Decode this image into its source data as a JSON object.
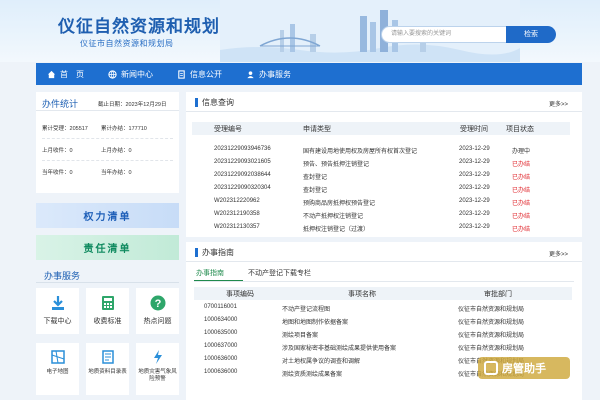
{
  "header": {
    "site_title": "仪征自然资源和规划",
    "site_subtitle": "仪征市自然资源和规划局",
    "search_placeholder": "请输入要搜索的关键词",
    "search_button": "检索"
  },
  "nav": {
    "items": [
      {
        "label": "首　页",
        "icon": "home-icon"
      },
      {
        "label": "新闻中心",
        "icon": "globe-icon"
      },
      {
        "label": "信息公开",
        "icon": "document-icon"
      },
      {
        "label": "办事服务",
        "icon": "user-icon"
      }
    ]
  },
  "stats": {
    "title": "办件统计",
    "date": "截止日期：2023年12月29日",
    "rows": [
      {
        "l1": "累计受理：",
        "v1": "205517",
        "l2": "累计办结：",
        "v2": "177710"
      },
      {
        "l1": "上月收件：",
        "v1": "0",
        "l2": "上月办结：",
        "v2": "0"
      },
      {
        "l1": "当年收件：",
        "v1": "0",
        "l2": "当年办结：",
        "v2": "0"
      }
    ]
  },
  "banners": {
    "power": "权力清单",
    "responsibility": "责任清单"
  },
  "services": {
    "title": "办事服务",
    "cards": [
      {
        "label": "下载中心",
        "icon": "download-icon"
      },
      {
        "label": "收费标准",
        "icon": "calculator-icon"
      },
      {
        "label": "热点问题",
        "icon": "question-icon"
      }
    ],
    "cards2": [
      {
        "label": "电子地图",
        "icon": "map-icon"
      },
      {
        "label": "地质资料目录表",
        "icon": "book-icon"
      },
      {
        "label": "地质灾害气象风险预警",
        "icon": "lightning-icon"
      }
    ]
  },
  "query": {
    "title": "信息查询",
    "more": "更多>>",
    "headers": [
      "受理编号",
      "申请类型",
      "受理时间",
      "项目状态"
    ],
    "rows": [
      {
        "no": "20231229093946736",
        "type": "国有建设用地使用权及房屋所有权首次登记",
        "time": "2023-12-29",
        "state": "办理中"
      },
      {
        "no": "20231229093021605",
        "type": "预告、预告抵押注销登记",
        "time": "2023-12-29",
        "state": "已办结"
      },
      {
        "no": "20231229092038644",
        "type": "查封登记",
        "time": "2023-12-29",
        "state": "已办结"
      },
      {
        "no": "20231229090320304",
        "type": "查封登记",
        "time": "2023-12-29",
        "state": "已办结"
      },
      {
        "no": "W202312220962",
        "type": "预购商品房抵押权预告登记",
        "time": "2023-12-29",
        "state": "已办结"
      },
      {
        "no": "W202312190358",
        "type": "不动产抵押权注销登记",
        "time": "2023-12-29",
        "state": "已办结"
      },
      {
        "no": "W202312130357",
        "type": "抵押权注销登记（过渡）",
        "time": "2023-12-29",
        "state": "已办结"
      }
    ]
  },
  "guide": {
    "title": "办事指南",
    "more": "更多>>",
    "tabs": [
      "办事指南",
      "不动产登记下载专栏"
    ],
    "headers": [
      "事项编码",
      "事项名称",
      "审批部门"
    ],
    "rows": [
      {
        "code": "0700116001",
        "name": "不动产登记流程图",
        "dept": "仪征市自然资源和规划局"
      },
      {
        "code": "1000634000",
        "name": "地图和地图制作依据备案",
        "dept": "仪征市自然资源和规划局"
      },
      {
        "code": "1000635000",
        "name": "测绘项目备案",
        "dept": "仪征市自然资源和规划局"
      },
      {
        "code": "1000637000",
        "name": "涉及国家秘密非基础测绘成果提供使用备案",
        "dept": "仪征市自然资源和规划局"
      },
      {
        "code": "1000636000",
        "name": "对土地权属争议的调查和调解",
        "dept": "仪征市自然资源和规划局"
      },
      {
        "code": "1000636000",
        "name": "测绘资质测绘成果备案",
        "dept": "仪征市自然资源和规划局"
      }
    ]
  },
  "watermark": {
    "text": "房管助手"
  },
  "colors": {
    "primary": "#1e6fd0",
    "done": "#e0282e",
    "green": "#1f8a4c"
  }
}
